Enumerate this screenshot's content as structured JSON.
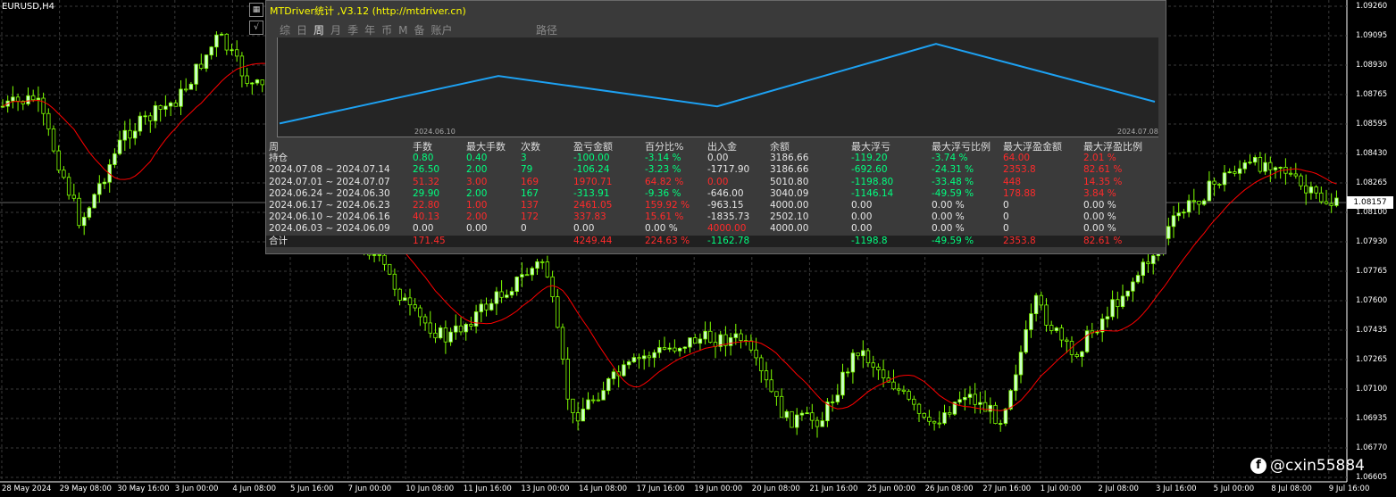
{
  "symbol": "EURUSD,H4",
  "current_price": "1.08157",
  "price_labels": [
    "1.09260",
    "1.09095",
    "1.08930",
    "1.08765",
    "1.08595",
    "1.08430",
    "1.08265",
    "1.08100",
    "1.07930",
    "1.07765",
    "1.07600",
    "1.07435",
    "1.07265",
    "1.07100",
    "1.06935",
    "1.06770",
    "1.06605"
  ],
  "time_labels": [
    "28 May 2024",
    "29 May 08:00",
    "30 May 16:00",
    "3 Jun 00:00",
    "4 Jun 08:00",
    "5 Jun 16:00",
    "7 Jun 00:00",
    "10 Jun 08:00",
    "11 Jun 16:00",
    "13 Jun 00:00",
    "14 Jun 08:00",
    "17 Jun 16:00",
    "19 Jun 00:00",
    "20 Jun 08:00",
    "21 Jun 16:00",
    "25 Jun 00:00",
    "26 Jun 08:00",
    "27 Jun 16:00",
    "1 Jul 00:00",
    "2 Jul 08:00",
    "3 Jul 16:00",
    "5 Jul 00:00",
    "8 Jul 08:00",
    "9 Jul 16:00"
  ],
  "colors": {
    "bull": "#ccffcc",
    "bear": "#7fff00",
    "ma": "#ff0000",
    "grid": "#3a3a3a",
    "mini_line": "#1da1f2"
  },
  "icons": [
    "calendar-icon",
    "checkmark-icon"
  ],
  "panel": {
    "title": "MTDriver统计 ,V3.12 (http://mtdriver.cn)",
    "tabs": [
      "综",
      "日",
      "周",
      "月",
      "季",
      "年",
      "币",
      "M",
      "备",
      "账户"
    ],
    "active_tab": "周",
    "path_label": "路径",
    "mini_chart": {
      "start_date": "2024.06.10",
      "end_date": "2024.07.08",
      "values": [
        2502.1,
        4000.0,
        3040.09,
        5010.8,
        3186.66
      ]
    },
    "headers": [
      "周",
      "手数",
      "最大手数",
      "次数",
      "盈亏金额",
      "百分比%",
      "出入金",
      "余额",
      "最大浮亏",
      "最大浮亏比例",
      "最大浮盈金额",
      "最大浮盈比例"
    ],
    "rows": [
      {
        "cells": [
          "持仓",
          "0.80",
          "0.40",
          "3",
          "-100.00",
          "-3.14 %",
          "0.00",
          "3186.66",
          "-119.20",
          "-3.74 %",
          "64.00",
          "2.01 %"
        ],
        "colors": [
          "w",
          "g",
          "g",
          "g",
          "g",
          "g",
          "w",
          "w",
          "g",
          "g",
          "r",
          "r"
        ]
      },
      {
        "cells": [
          "2024.07.08 ~ 2024.07.14",
          "26.50",
          "2.00",
          "79",
          "-106.24",
          "-3.23 %",
          "-1717.90",
          "3186.66",
          "-692.60",
          "-24.31 %",
          "2353.8",
          "82.61 %"
        ],
        "colors": [
          "w",
          "g",
          "g",
          "g",
          "g",
          "g",
          "w",
          "w",
          "g",
          "g",
          "r",
          "r"
        ]
      },
      {
        "cells": [
          "2024.07.01 ~ 2024.07.07",
          "51.32",
          "3.00",
          "169",
          "1970.71",
          "64.82 %",
          "0.00",
          "5010.80",
          "-1198.80",
          "-33.48 %",
          "448",
          "14.35 %"
        ],
        "colors": [
          "w",
          "r",
          "r",
          "r",
          "r",
          "r",
          "r",
          "w",
          "g",
          "g",
          "r",
          "r"
        ]
      },
      {
        "cells": [
          "2024.06.24 ~ 2024.06.30",
          "29.90",
          "2.00",
          "167",
          "-313.91",
          "-9.36 %",
          "-646.00",
          "3040.09",
          "-1146.14",
          "-49.59 %",
          "178.88",
          "3.84 %"
        ],
        "colors": [
          "w",
          "g",
          "g",
          "g",
          "g",
          "g",
          "w",
          "w",
          "g",
          "g",
          "r",
          "r"
        ]
      },
      {
        "cells": [
          "2024.06.17 ~ 2024.06.23",
          "22.80",
          "1.00",
          "137",
          "2461.05",
          "159.92 %",
          "-963.15",
          "4000.00",
          "0.00",
          "0.00 %",
          "0",
          "0.00 %"
        ],
        "colors": [
          "w",
          "r",
          "r",
          "r",
          "r",
          "r",
          "w",
          "w",
          "w",
          "w",
          "w",
          "w"
        ]
      },
      {
        "cells": [
          "2024.06.10 ~ 2024.06.16",
          "40.13",
          "2.00",
          "172",
          "337.83",
          "15.61 %",
          "-1835.73",
          "2502.10",
          "0.00",
          "0.00 %",
          "0",
          "0.00 %"
        ],
        "colors": [
          "w",
          "r",
          "r",
          "r",
          "r",
          "r",
          "w",
          "w",
          "w",
          "w",
          "w",
          "w"
        ]
      },
      {
        "cells": [
          "2024.06.03 ~ 2024.06.09",
          "0.00",
          "0.00",
          "0",
          "0.00",
          "0.00 %",
          "4000.00",
          "4000.00",
          "0.00",
          "0.00 %",
          "0",
          "0.00 %"
        ],
        "colors": [
          "w",
          "w",
          "w",
          "w",
          "w",
          "w",
          "r",
          "w",
          "w",
          "w",
          "w",
          "w"
        ]
      },
      {
        "cells": [
          "合计",
          "171.45",
          "",
          "",
          "4249.44",
          "224.63 %",
          "-1162.78",
          "",
          "-1198.8",
          "-49.59 %",
          "2353.8",
          "82.61 %"
        ],
        "colors": [
          "w",
          "r",
          "w",
          "w",
          "r",
          "r",
          "g",
          "w",
          "g",
          "g",
          "r",
          "r"
        ]
      }
    ]
  },
  "watermark": "@cxin55884"
}
